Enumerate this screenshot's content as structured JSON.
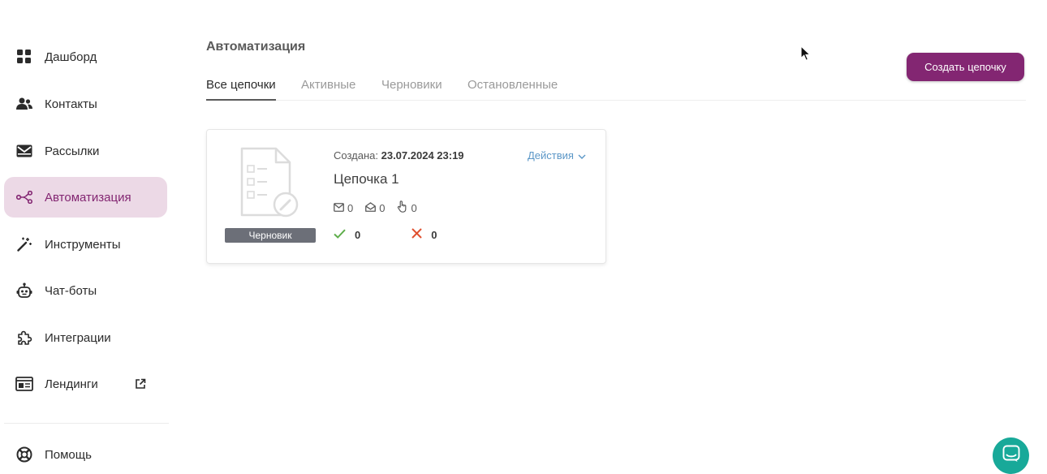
{
  "sidebar": {
    "items": [
      {
        "label": "Дашборд",
        "icon": "dashboard-grid-icon"
      },
      {
        "label": "Контакты",
        "icon": "contacts-people-icon"
      },
      {
        "label": "Рассылки",
        "icon": "mail-icon"
      },
      {
        "label": "Автоматизация",
        "icon": "automation-share-icon",
        "active": true
      },
      {
        "label": "Инструменты",
        "icon": "magic-wand-icon"
      },
      {
        "label": "Чат-боты",
        "icon": "robot-icon"
      },
      {
        "label": "Интеграции",
        "icon": "puzzle-icon"
      },
      {
        "label": "Лендинги",
        "icon": "landing-page-icon",
        "external_icon": "external-link-icon"
      }
    ],
    "help": {
      "label": "Помощь",
      "icon": "lifebuoy-icon"
    }
  },
  "header": {
    "title": "Автоматизация",
    "create_button": "Создать цепочку"
  },
  "tabs": [
    {
      "label": "Все цепочки",
      "active": true
    },
    {
      "label": "Активные"
    },
    {
      "label": "Черновики"
    },
    {
      "label": "Остановленные"
    }
  ],
  "chain_card": {
    "created_label": "Создана:",
    "created_value": "23.07.2024 23:19",
    "actions_label": "Действия",
    "name": "Цепочка 1",
    "status_badge": "Черновик",
    "stats": {
      "sent": "0",
      "opened": "0",
      "clicked": "0"
    },
    "results": {
      "success": "0",
      "failed": "0"
    }
  },
  "colors": {
    "brand": "#832672",
    "active_bg": "#ecd9e6",
    "link": "#5b97c7",
    "success": "#5fae4c",
    "error": "#e0502f",
    "chat": "#18a999",
    "badge": "#6c6f78"
  }
}
